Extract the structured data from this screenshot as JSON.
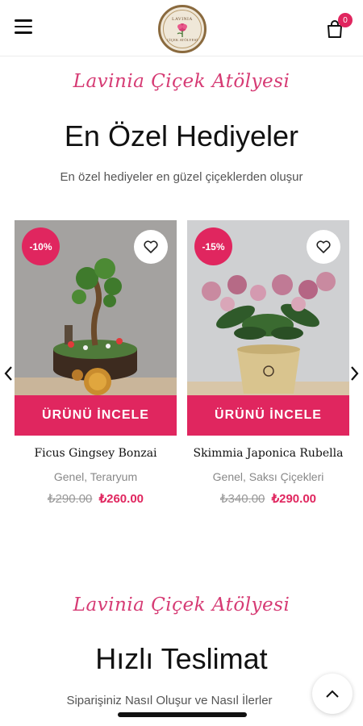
{
  "header": {
    "logo_top": "LAVINIA",
    "logo_bottom": "ÇİÇEK ATÖLYESİ",
    "cart_count": "0"
  },
  "section1": {
    "script_title": "Lavinia Çiçek Atölyesi",
    "title": "En Özel Hediyeler",
    "subtitle": "En özel hediyeler en güzel çiçeklerden oluşur"
  },
  "products": [
    {
      "discount": "-10%",
      "cta": "ÜRÜNÜ İNCELE",
      "name": "Ficus Gingsey Bonzai",
      "category": "Genel, Teraryum",
      "old_price": "₺290.00",
      "new_price": "₺260.00"
    },
    {
      "discount": "-15%",
      "cta": "ÜRÜNÜ İNCELE",
      "name": "Skimmia Japonica Rubella",
      "category": "Genel, Saksı Çiçekleri",
      "old_price": "₺340.00",
      "new_price": "₺290.00"
    }
  ],
  "section2": {
    "script_title": "Lavinia Çiçek Atölyesi",
    "title": "Hızlı Teslimat",
    "subtitle": "Siparişiniz Nasıl Oluşur ve Nasıl İlerler"
  },
  "icons": {
    "menu": "hamburger-menu-icon",
    "cart": "shopping-bag-icon",
    "wishlist": "heart-icon",
    "prev": "chevron-left-icon",
    "next": "chevron-right-icon",
    "top": "chevron-up-icon"
  },
  "colors": {
    "accent": "#e0265f",
    "script": "#d63b74"
  }
}
